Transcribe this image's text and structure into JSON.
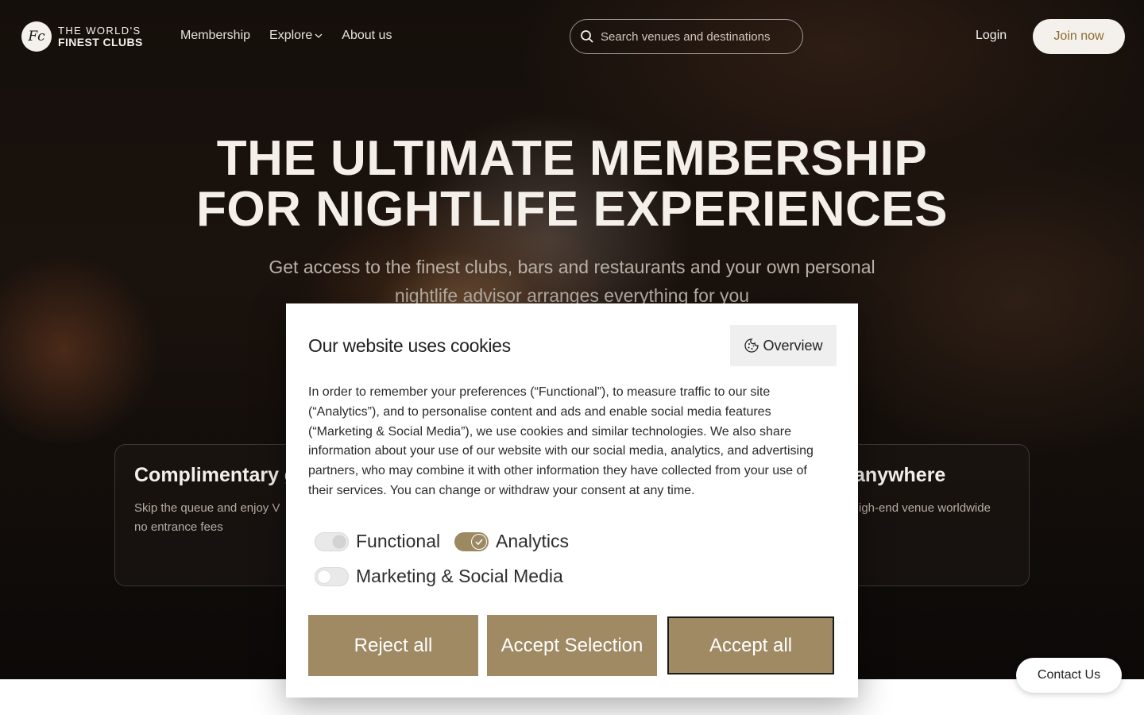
{
  "header": {
    "logo_mark": "Fc",
    "logo_line1": "THE WORLD'S",
    "logo_line2": "FINEST CLUBS",
    "nav": [
      {
        "label": "Membership"
      },
      {
        "label": "Explore"
      },
      {
        "label": "About us"
      }
    ],
    "search_placeholder": "Search venues and destinations",
    "login_label": "Login",
    "join_label": "Join now"
  },
  "hero": {
    "title_line1": "THE ULTIMATE MEMBERSHIP",
    "title_line2": "FOR NIGHTLIFE EXPERIENCES",
    "subtitle": "Get access to the finest clubs, bars and restaurants and your own personal nightlife advisor arranges everything for you"
  },
  "features": {
    "left_title": "Complimentary g",
    "left_text": "Skip the queue and enjoy V",
    "left_text2": "no entrance fees",
    "right_title": "anywhere",
    "right_text": "igh-end venue worldwide"
  },
  "cookie_modal": {
    "title": "Our website uses cookies",
    "overview_label": "Overview",
    "body": "In order to remember your preferences (“Functional”), to measure traffic to our site (“Analytics”), and to personalise content and ads and enable social media features (“Marketing & Social Media”), we use cookies and similar technologies. We also share information about your use of our website with our social media, analytics, and advertising partners, who may combine it with other information they have collected from your use of their services. You can change or withdraw your consent at any time.",
    "toggles": [
      {
        "label": "Functional",
        "state": "on-disabled"
      },
      {
        "label": "Analytics",
        "state": "on"
      },
      {
        "label": "Marketing & Social Media",
        "state": "off"
      }
    ],
    "reject_label": "Reject all",
    "accept_selection_label": "Accept Selection",
    "accept_all_label": "Accept all"
  },
  "contact_label": "Contact Us",
  "colors": {
    "accent_gold": "#9f8a63",
    "join_text": "#8a6b2e"
  }
}
